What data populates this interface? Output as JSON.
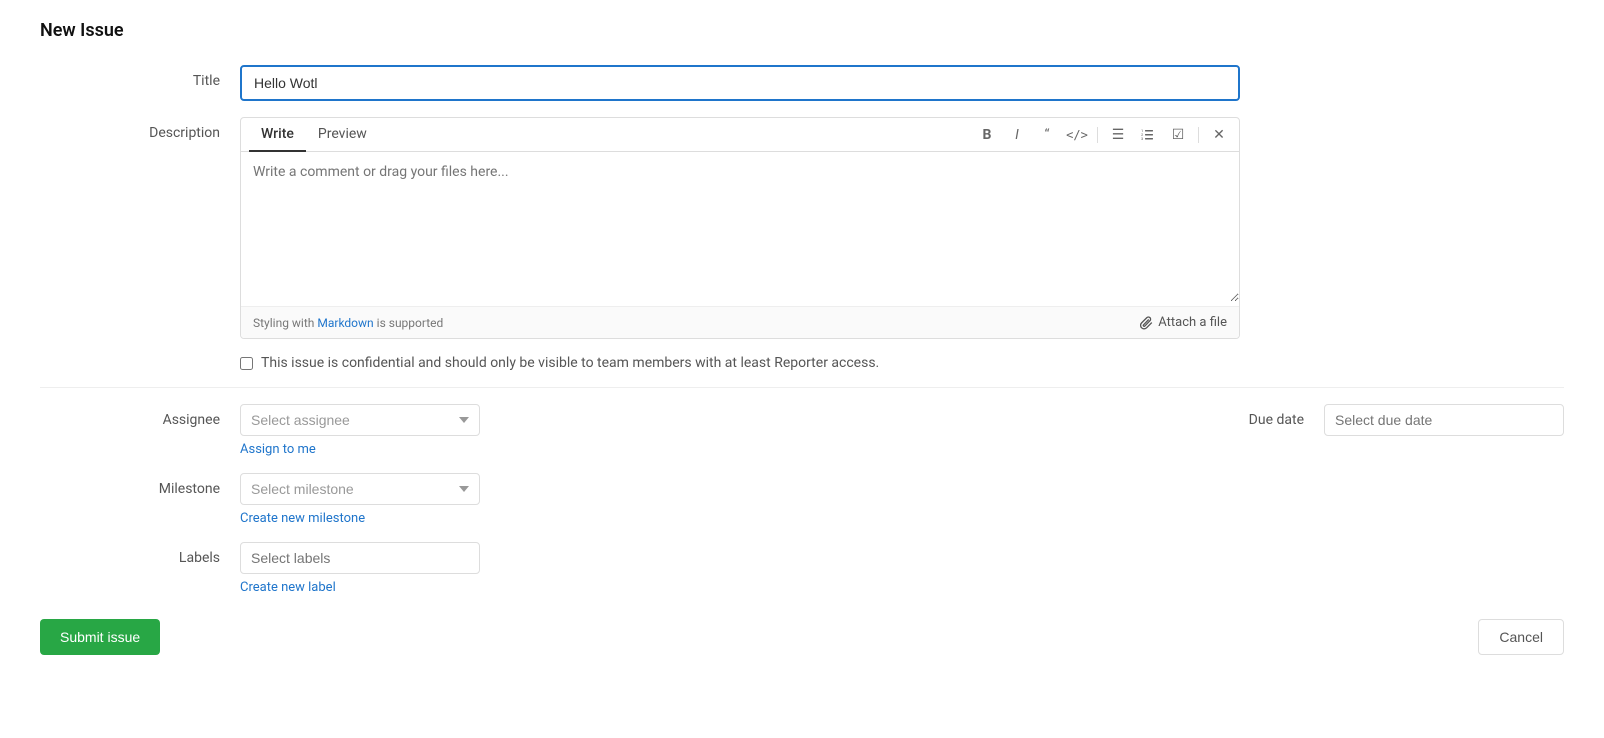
{
  "page": {
    "title": "New Issue"
  },
  "title_field": {
    "label": "Title",
    "value": "Hello Wotl",
    "placeholder": ""
  },
  "description_field": {
    "label": "Description",
    "write_tab": "Write",
    "preview_tab": "Preview",
    "placeholder": "Write a comment or drag your files here...",
    "markdown_note": "Styling with",
    "markdown_link_text": "Markdown",
    "markdown_suffix": "is supported",
    "attach_label": "Attach a file"
  },
  "toolbar": {
    "bold": "B",
    "italic": "I",
    "quote": "“",
    "code": "</>",
    "unordered_list": "≡",
    "ordered_list": "≡",
    "checkbox": "☑",
    "fullscreen": "✕"
  },
  "confidential": {
    "label": "This issue is confidential and should only be visible to team members with at least Reporter access."
  },
  "assignee": {
    "label": "Assignee",
    "placeholder": "Select assignee",
    "assign_to_me": "Assign to me"
  },
  "due_date": {
    "label": "Due date",
    "placeholder": "Select due date"
  },
  "milestone": {
    "label": "Milestone",
    "placeholder": "Select milestone",
    "create_link": "Create new milestone"
  },
  "labels": {
    "label": "Labels",
    "placeholder": "Select labels",
    "create_link": "Create new label"
  },
  "actions": {
    "submit": "Submit issue",
    "cancel": "Cancel"
  }
}
